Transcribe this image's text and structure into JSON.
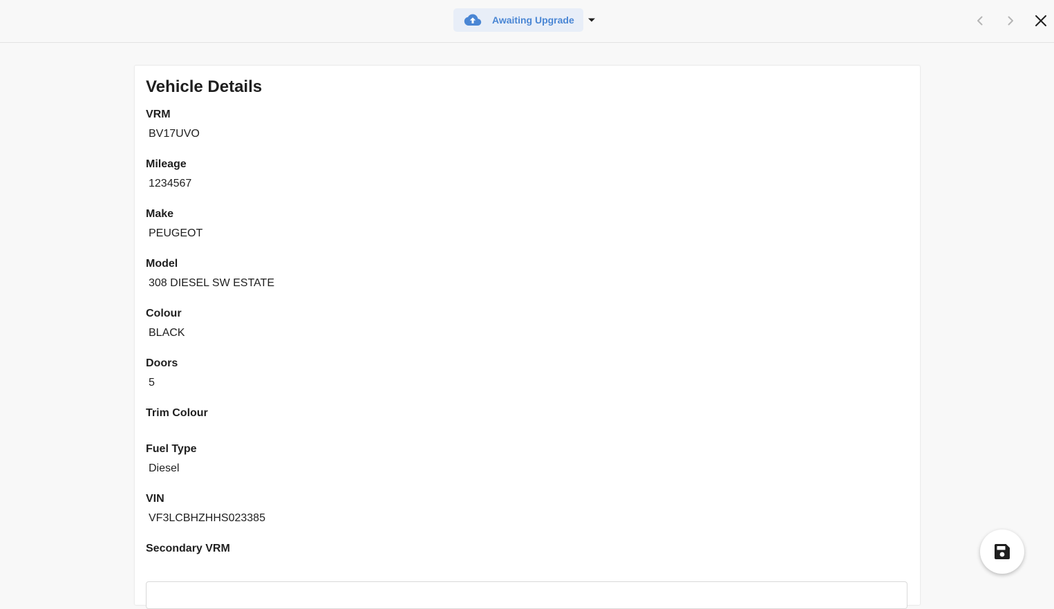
{
  "header": {
    "status_label": "Awaiting Upgrade",
    "status_icon": "cloud-upload-icon",
    "accent_color": "#4a86d4",
    "nav": {
      "prev_icon": "chevron-left-icon",
      "next_icon": "chevron-right-icon",
      "close_icon": "close-icon"
    }
  },
  "card": {
    "title": "Vehicle Details",
    "fields": {
      "vrm": {
        "label": "VRM",
        "value": "BV17UVO"
      },
      "mileage": {
        "label": "Mileage",
        "value": "1234567"
      },
      "make": {
        "label": "Make",
        "value": "PEUGEOT"
      },
      "model": {
        "label": "Model",
        "value": "308 DIESEL SW ESTATE"
      },
      "colour": {
        "label": "Colour",
        "value": "BLACK"
      },
      "doors": {
        "label": "Doors",
        "value": "5"
      },
      "trim_colour": {
        "label": "Trim Colour",
        "value": ""
      },
      "fuel_type": {
        "label": "Fuel Type",
        "value": "Diesel"
      },
      "vin": {
        "label": "VIN",
        "value": "VF3LCBHZHHS023385"
      },
      "secondary_vrm": {
        "label": "Secondary VRM",
        "value": ""
      }
    }
  },
  "fab": {
    "icon": "save-icon"
  }
}
